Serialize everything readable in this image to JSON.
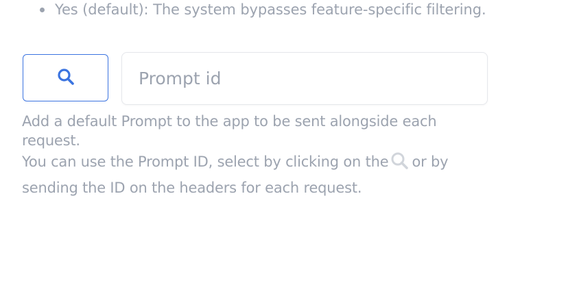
{
  "option_list": {
    "item_text": "Yes (default): The system bypasses feature-specific filtering."
  },
  "prompt_selector": {
    "search_icon": "search-icon",
    "input_placeholder": "Prompt id",
    "input_value": ""
  },
  "help": {
    "line1": "Add a default Prompt to the app to be sent alongside each request.",
    "line2_before_icon": "You can use the Prompt ID, select by clicking on the",
    "inline_icon": "search-icon",
    "line2_after_icon": "or by sending the ID on the headers for each request."
  },
  "colors": {
    "accent": "#3b74e0",
    "muted_text": "#9ca3af",
    "input_border": "#e5e7eb"
  }
}
